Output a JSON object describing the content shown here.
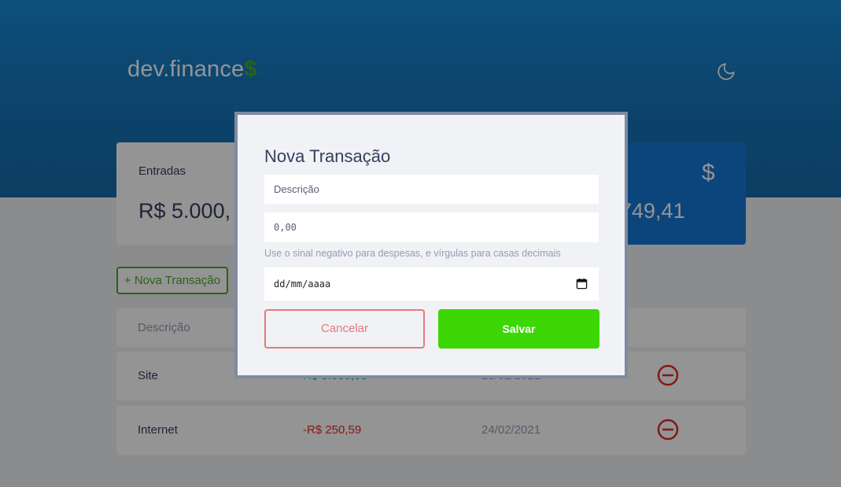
{
  "header": {
    "logo_text": "dev.finance",
    "logo_symbol": "$",
    "theme_icon": "moon-icon"
  },
  "cards": {
    "income": {
      "title": "Entradas",
      "value": "R$ 5.000,"
    },
    "total": {
      "value": "749,41",
      "icon": "dollar-icon"
    }
  },
  "new_transaction_label": "+ Nova Transação",
  "table": {
    "headers": [
      "Descrição"
    ],
    "rows": [
      {
        "description": "Site",
        "amount": "R$ 5.000,00",
        "date": "23/02/2021"
      },
      {
        "description": "Internet",
        "amount": "-R$ 250,59",
        "date": "24/02/2021"
      }
    ]
  },
  "modal": {
    "title": "Nova Transação",
    "description_placeholder": "Descrição",
    "amount_placeholder": "0,00",
    "help_text": "Use o sinal negativo para despesas, e vírgulas para casas decimais",
    "date_placeholder": "dd/mm/aaaa",
    "cancel_label": "Cancelar",
    "save_label": "Salvar"
  },
  "colors": {
    "header": "#1577bd",
    "income_green": "#49aa26",
    "expense_red": "#e92929",
    "save_green": "#3dd705",
    "cancel_red": "#e47a7a",
    "total_blue": "#1577d6"
  }
}
